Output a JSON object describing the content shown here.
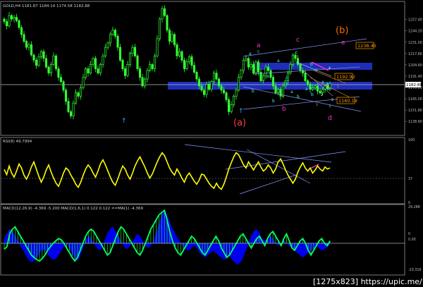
{
  "chart_data": [
    {
      "type": "candlestick",
      "panel": "price",
      "header_text": "GOLD,H4  1181.87  1184.14  1174.58  1182.88",
      "y_tick_labels": [
        "1257.40",
        "1244.20",
        "1231.00",
        "1217.80",
        "1204.60",
        "1191.40",
        "1178.20",
        "1165.00",
        "1151.80",
        "1138.60"
      ],
      "current_price_label": "1182.88",
      "price_tags": [
        "1238.45",
        "1192.92",
        "1160.19"
      ],
      "wave_labels": [
        {
          "text": "(a)",
          "color": "#ff3c3c"
        },
        {
          "text": "(b)",
          "color": "#ff6600"
        },
        {
          "text": "a",
          "color": "#ff33cc"
        },
        {
          "text": "b",
          "color": "#ff33cc"
        },
        {
          "text": "c",
          "color": "#ff33cc"
        },
        {
          "text": "d",
          "color": "#ff33cc"
        },
        {
          "text": "e",
          "color": "#ff33cc"
        },
        {
          "text": "a",
          "color": "#33ffff"
        },
        {
          "text": "b",
          "color": "#33ffff"
        },
        {
          "text": "c",
          "color": "#33ffff"
        },
        {
          "text": "a",
          "color": "#33ffff"
        },
        {
          "text": "b",
          "color": "#33ffff"
        },
        {
          "text": "c",
          "color": "#33ffff"
        },
        {
          "text": "a",
          "color": "#33ffff"
        },
        {
          "text": "b",
          "color": "#33ffff"
        },
        {
          "text": "c",
          "color": "#33ffff"
        },
        {
          "text": "a",
          "color": "#33ffff"
        },
        {
          "text": "b",
          "color": "#33ffff"
        },
        {
          "text": "c",
          "color": "#33ffff"
        },
        {
          "text": "a",
          "color": "#33ffff"
        },
        {
          "text": "b",
          "color": "#33ffff"
        },
        {
          "text": "c",
          "color": "#33ffff"
        },
        {
          "text": "b",
          "color": "#33ffff"
        },
        {
          "text": "a",
          "color": "#33ffff"
        },
        {
          "text": "b",
          "color": "#33ffff"
        },
        {
          "text": "c",
          "color": "#33ffff"
        },
        {
          "text": "5",
          "color": "#ffffff"
        },
        {
          "text": "4",
          "color": "#ffffff"
        },
        {
          "text": "3",
          "color": "#ff9900"
        },
        {
          "text": "2",
          "color": "#ffffff"
        },
        {
          "text": "1",
          "color": "#ff9900"
        }
      ],
      "close_series": [
        1255,
        1250,
        1262,
        1258,
        1260,
        1256,
        1248,
        1240,
        1232,
        1225,
        1228,
        1216,
        1210,
        1204,
        1214,
        1220,
        1212,
        1202,
        1195,
        1205,
        1215,
        1200,
        1190,
        1185,
        1175,
        1162,
        1150,
        1145,
        1160,
        1172,
        1168,
        1178,
        1190,
        1200,
        1195,
        1205,
        1212,
        1200,
        1195,
        1205,
        1215,
        1225,
        1230,
        1240,
        1245,
        1238,
        1225,
        1210,
        1200,
        1192,
        1205,
        1218,
        1225,
        1215,
        1200,
        1190,
        1180,
        1188,
        1198,
        1205,
        1200,
        1215,
        1235,
        1258,
        1270,
        1262,
        1245,
        1232,
        1240,
        1228,
        1215,
        1220,
        1210,
        1200,
        1208,
        1214,
        1204,
        1196,
        1188,
        1180,
        1175,
        1170,
        1182,
        1176,
        1185,
        1195,
        1188,
        1180,
        1175,
        1172,
        1164,
        1150,
        1158,
        1168,
        1175,
        1190,
        1198,
        1210,
        1212,
        1202,
        1205,
        1195,
        1208,
        1196,
        1186,
        1192,
        1202,
        1198,
        1190,
        1180,
        1172,
        1176,
        1168,
        1180,
        1186,
        1195,
        1205,
        1216,
        1212,
        1205,
        1198,
        1195,
        1186,
        1182,
        1176,
        1178,
        1180,
        1174,
        1172,
        1176,
        1180,
        1177,
        1183
      ]
    },
    {
      "type": "line",
      "panel": "rsi",
      "header_text": "RSI(8) 49.7994",
      "y_tick_labels": [
        "100",
        "37",
        "0"
      ],
      "level": 37,
      "ylim": [
        0,
        100
      ],
      "values": [
        55,
        45,
        62,
        48,
        40,
        52,
        66,
        58,
        44,
        36,
        46,
        60,
        70,
        56,
        42,
        30,
        40,
        54,
        64,
        50,
        38,
        28,
        22,
        34,
        48,
        58,
        54,
        44,
        36,
        26,
        20,
        30,
        44,
        56,
        64,
        58,
        48,
        40,
        52,
        66,
        74,
        64,
        52,
        40,
        30,
        24,
        36,
        50,
        62,
        56,
        44,
        36,
        48,
        62,
        72,
        80,
        70,
        60,
        48,
        38,
        46,
        58,
        70,
        80,
        88,
        82,
        70,
        58,
        50,
        44,
        56,
        48,
        38,
        30,
        42,
        48,
        40,
        32,
        26,
        34,
        46,
        44,
        36,
        28,
        22,
        18,
        28,
        20,
        16,
        26,
        40,
        56,
        68,
        80,
        88,
        84,
        74,
        64,
        58,
        70,
        62,
        54,
        62,
        70,
        60,
        52,
        56,
        64,
        58,
        48,
        56,
        70,
        76,
        66,
        54,
        44,
        36,
        28,
        36,
        50,
        60,
        68,
        58,
        52,
        58,
        48,
        54,
        62,
        56,
        52,
        60,
        56,
        58
      ]
    },
    {
      "type": "line",
      "panel": "macd",
      "header_text": "MACD(12,26,9) -4.369 -5.200  MACD(1,6,1) 0.122 0.122  ==MA(1) -4.369",
      "y_tick_labels": [
        "29.288",
        "0.00",
        "-23.316"
      ],
      "zero_label": "0",
      "ylim": [
        -23.316,
        29.288
      ],
      "macd_values": [
        4,
        8,
        12,
        10,
        6,
        2,
        -2,
        -6,
        -10,
        -14,
        -16,
        -15,
        -12,
        -8,
        -5,
        -6,
        -9,
        -12,
        -14,
        -13,
        -10,
        -6,
        -3,
        0,
        -4,
        -8,
        -12,
        -15,
        -10,
        -4,
        2,
        6,
        4,
        0,
        -3,
        -6,
        -4,
        2,
        8,
        12,
        14,
        10,
        6,
        2,
        -2,
        -5,
        -3,
        0,
        4,
        8,
        6,
        2,
        -2,
        -4,
        -2,
        2,
        8,
        16,
        24,
        28,
        24,
        18,
        12,
        8,
        4,
        0,
        -3,
        -5,
        -6,
        -4,
        -2,
        -4,
        -8,
        -10,
        -12,
        -10,
        -8,
        -6,
        -8,
        -10,
        -12,
        -14,
        -12,
        -10,
        -14,
        -16,
        -18,
        -16,
        -12,
        -6,
        0,
        6,
        10,
        12,
        8,
        4,
        2,
        4,
        6,
        4,
        0,
        -2,
        0,
        2,
        0,
        -2,
        -4,
        -6,
        -8,
        -10,
        -12,
        -10,
        -8,
        -6,
        -4,
        -2,
        -4,
        -6,
        -5,
        -3,
        -1
      ],
      "signal_values": [
        3,
        6,
        9,
        10,
        8,
        5,
        1,
        -3,
        -7,
        -11,
        -14,
        -15,
        -14,
        -11,
        -8,
        -7,
        -8,
        -10,
        -12,
        -13,
        -12,
        -9,
        -6,
        -3,
        -3,
        -6,
        -9,
        -12,
        -12,
        -8,
        -3,
        2,
        4,
        2,
        -1,
        -4,
        -4,
        0,
        5,
        9,
        12,
        12,
        9,
        5,
        1,
        -3,
        -4,
        -2,
        2,
        6,
        6,
        4,
        0,
        -3,
        -3,
        0,
        5,
        12,
        19,
        25,
        26,
        22,
        16,
        11,
        6,
        2,
        -1,
        -3,
        -5,
        -5,
        -4,
        -4,
        -6,
        -8,
        -10,
        -11,
        -10,
        -8,
        -8,
        -9,
        -11,
        -12,
        -12,
        -11,
        -12,
        -14,
        -16,
        -16,
        -14,
        -10,
        -5,
        1,
        6,
        9,
        9,
        6,
        4,
        3,
        5,
        5,
        2,
        -1,
        -1,
        1,
        1,
        -1,
        -3,
        -5,
        -7,
        -9,
        -11,
        -11,
        -10,
        -8,
        -6,
        -4,
        -4,
        -5,
        -5,
        -4,
        -3
      ],
      "osc_values": [
        -5,
        -3,
        8,
        12,
        14,
        10,
        6,
        2,
        -2,
        -6,
        -10,
        -12,
        -14,
        -15,
        -13,
        -10,
        -6,
        -3,
        0,
        2,
        4,
        3,
        0,
        -4,
        -8,
        -12,
        -15,
        -12,
        -6,
        0,
        6,
        10,
        12,
        10,
        6,
        2,
        -2,
        -6,
        -10,
        -8,
        -2,
        4,
        10,
        14,
        12,
        8,
        4,
        0,
        -4,
        -8,
        -10,
        -6,
        0,
        6,
        12,
        16,
        20,
        24,
        26,
        28,
        20,
        10,
        2,
        -4,
        -8,
        -10,
        -6,
        -2,
        2,
        6,
        4,
        0,
        -4,
        -8,
        -10,
        -6,
        -2,
        2,
        6,
        2,
        -4,
        -8,
        -12,
        -10,
        -6,
        -2,
        2,
        6,
        8,
        4,
        0,
        -4,
        0,
        4,
        6,
        2,
        -2,
        4,
        8,
        10,
        6,
        2,
        -2,
        4,
        8,
        2,
        -4,
        -6,
        -2,
        2,
        4,
        0,
        -6,
        -10,
        -6,
        -2,
        2,
        4,
        0,
        -2,
        2
      ]
    }
  ],
  "watermark": "[1275x823] https://upic.me/"
}
